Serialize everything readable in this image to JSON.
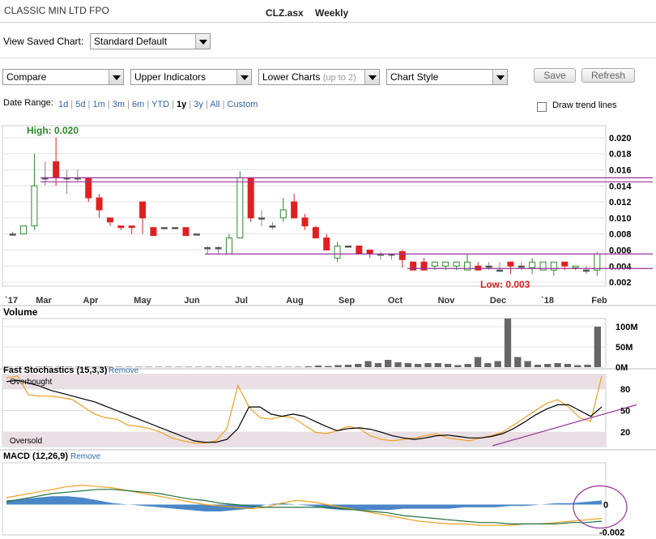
{
  "header": {
    "company": "CLASSIC MIN LTD FPO",
    "ticker": "CLZ.asx",
    "period": "Weekly"
  },
  "saved_chart": {
    "label": "View Saved Chart:",
    "value": "Standard Default"
  },
  "toolbar": {
    "compare": "Compare",
    "upper": "Upper Indicators",
    "lower": "Lower Charts",
    "lower_hint": "(up to 2)",
    "style": "Chart Style",
    "save": "Save",
    "refresh": "Refresh"
  },
  "date_range": {
    "label": "Date Range:",
    "options": [
      "1d",
      "5d",
      "1m",
      "3m",
      "6m",
      "YTD",
      "1y",
      "3y",
      "All",
      "Custom"
    ],
    "selected": "1y"
  },
  "trend": {
    "label": "Draw trend lines",
    "checked": false
  },
  "colors": {
    "up": "#2e8b2e",
    "down": "#e02020",
    "neutral": "#555555",
    "bar": "#666666",
    "stoch_fast": "#f0a020",
    "stoch_slow": "#000000",
    "macd_line": "#f0a020",
    "signal_line": "#207040",
    "hist": "#4a86c8",
    "trend": "#993399",
    "high": "#2a8a2a",
    "low": "#e02020"
  },
  "chart_data": [
    {
      "type": "candlestick",
      "title": "",
      "high_label": "High: 0.020",
      "low_label": "Low: 0.003",
      "y_ticks": [
        "0.020",
        "0.018",
        "0.016",
        "0.014",
        "0.012",
        "0.010",
        "0.008",
        "0.006",
        "0.004",
        "0.002"
      ],
      "ylim": [
        0.0015,
        0.0215
      ],
      "x_labels": [
        "`17",
        "Mar",
        "Apr",
        "May",
        "Jun",
        "Jul",
        "Aug",
        "Sep",
        "Oct",
        "Nov",
        "Dec",
        "`18",
        "Feb"
      ],
      "ohlc": [
        [
          0.008,
          0.0083,
          0.0078,
          0.008
        ],
        [
          0.008,
          0.009,
          0.008,
          0.009
        ],
        [
          0.009,
          0.018,
          0.0085,
          0.014
        ],
        [
          0.015,
          0.017,
          0.014,
          0.015
        ],
        [
          0.017,
          0.02,
          0.014,
          0.015
        ],
        [
          0.015,
          0.016,
          0.013,
          0.015
        ],
        [
          0.015,
          0.016,
          0.0145,
          0.015
        ],
        [
          0.015,
          0.015,
          0.012,
          0.0125
        ],
        [
          0.0125,
          0.013,
          0.01,
          0.011
        ],
        [
          0.01,
          0.01,
          0.009,
          0.0095
        ],
        [
          0.009,
          0.009,
          0.0085,
          0.0088
        ],
        [
          0.009,
          0.009,
          0.008,
          0.0088
        ],
        [
          0.012,
          0.012,
          0.008,
          0.01
        ],
        [
          0.0088,
          0.0088,
          0.0078,
          0.0078
        ],
        [
          0.0088,
          0.0088,
          0.0088,
          0.0088
        ],
        [
          0.0088,
          0.0088,
          0.0088,
          0.0088
        ],
        [
          0.0088,
          0.0088,
          0.0078,
          0.0078
        ],
        [
          0.008,
          0.008,
          0.008,
          0.008
        ],
        [
          0.0063,
          0.0065,
          0.0055,
          0.0063
        ],
        [
          0.0063,
          0.0065,
          0.0055,
          0.0063
        ],
        [
          0.0055,
          0.008,
          0.0055,
          0.0075
        ],
        [
          0.0075,
          0.0158,
          0.0075,
          0.015
        ],
        [
          0.015,
          0.015,
          0.0095,
          0.01
        ],
        [
          0.01,
          0.011,
          0.009,
          0.01
        ],
        [
          0.009,
          0.0095,
          0.0085,
          0.009
        ],
        [
          0.01,
          0.0125,
          0.0095,
          0.011
        ],
        [
          0.012,
          0.013,
          0.01,
          0.01
        ],
        [
          0.01,
          0.0105,
          0.0085,
          0.009
        ],
        [
          0.0088,
          0.009,
          0.0075,
          0.0075
        ],
        [
          0.0075,
          0.008,
          0.006,
          0.006
        ],
        [
          0.005,
          0.007,
          0.0045,
          0.0065
        ],
        [
          0.0065,
          0.0065,
          0.0065,
          0.0065
        ],
        [
          0.0065,
          0.0065,
          0.0055,
          0.0055
        ],
        [
          0.006,
          0.006,
          0.005,
          0.0055
        ],
        [
          0.0055,
          0.0058,
          0.0048,
          0.0055
        ],
        [
          0.0055,
          0.0055,
          0.0048,
          0.0055
        ],
        [
          0.0058,
          0.006,
          0.0038,
          0.0048
        ],
        [
          0.0045,
          0.0045,
          0.0035,
          0.0035
        ],
        [
          0.0045,
          0.005,
          0.0035,
          0.0035
        ],
        [
          0.004,
          0.0045,
          0.0035,
          0.0045
        ],
        [
          0.004,
          0.0045,
          0.0035,
          0.0045
        ],
        [
          0.004,
          0.0045,
          0.0035,
          0.0045
        ],
        [
          0.0035,
          0.0055,
          0.0035,
          0.0045
        ],
        [
          0.004,
          0.0045,
          0.0035,
          0.0035
        ],
        [
          0.004,
          0.0045,
          0.0035,
          0.004
        ],
        [
          0.0035,
          0.0045,
          0.0035,
          0.0035
        ],
        [
          0.0045,
          0.0045,
          0.003,
          0.004
        ],
        [
          0.004,
          0.0045,
          0.0035,
          0.004
        ],
        [
          0.0038,
          0.005,
          0.003,
          0.0045
        ],
        [
          0.0035,
          0.0045,
          0.0035,
          0.0045
        ],
        [
          0.0035,
          0.0045,
          0.0028,
          0.0045
        ],
        [
          0.0045,
          0.0045,
          0.0035,
          0.004
        ],
        [
          0.0038,
          0.004,
          0.0035,
          0.004
        ],
        [
          0.0035,
          0.004,
          0.003,
          0.0035
        ],
        [
          0.0035,
          0.0058,
          0.0028,
          0.0055
        ]
      ],
      "resistance": 0.015,
      "resistance2": 0.0145,
      "support": 0.0055,
      "support2": 0.0037
    },
    {
      "type": "bar",
      "title": "Volume",
      "y_ticks": [
        "100M",
        "50M",
        "0M"
      ],
      "ylim": [
        0,
        120
      ],
      "values": [
        1,
        1,
        1,
        1,
        1,
        1,
        1,
        1,
        1,
        1,
        1,
        1,
        1,
        1,
        1,
        1,
        1,
        1,
        1,
        1,
        1,
        1,
        1,
        1,
        1,
        1,
        1,
        1,
        1,
        1,
        2,
        4,
        3,
        5,
        6,
        8,
        15,
        10,
        18,
        12,
        10,
        8,
        10,
        10,
        8,
        5,
        8,
        25,
        10,
        15,
        120,
        25,
        15,
        6,
        8,
        10,
        8,
        5,
        6,
        100
      ]
    },
    {
      "type": "line",
      "title": "Fast Stochastics (15,3,3)",
      "remove": "Remove",
      "overbought": "Overbought",
      "oversold": "Oversold",
      "y_ticks": [
        "80",
        "50",
        "20"
      ],
      "ylim": [
        0,
        100
      ],
      "fast": [
        95,
        98,
        72,
        70,
        70,
        68,
        65,
        55,
        45,
        40,
        38,
        30,
        28,
        25,
        20,
        12,
        8,
        5,
        5,
        8,
        25,
        85,
        55,
        40,
        38,
        42,
        40,
        30,
        20,
        18,
        22,
        28,
        25,
        15,
        10,
        8,
        10,
        12,
        15,
        18,
        12,
        10,
        8,
        12,
        15,
        20,
        30,
        40,
        50,
        60,
        65,
        55,
        40,
        35,
        98
      ],
      "slow": [
        90,
        92,
        88,
        84,
        78,
        74,
        70,
        66,
        62,
        56,
        50,
        44,
        38,
        32,
        26,
        20,
        14,
        8,
        6,
        6,
        10,
        25,
        55,
        55,
        45,
        42,
        45,
        42,
        35,
        28,
        22,
        25,
        26,
        24,
        20,
        15,
        12,
        10,
        12,
        15,
        16,
        14,
        12,
        12,
        14,
        18,
        25,
        34,
        44,
        52,
        58,
        58,
        50,
        42,
        55
      ],
      "trend_from": [
        17,
        38
      ],
      "trend_to": [
        100,
        55
      ]
    },
    {
      "type": "line",
      "title": "MACD (12,26,9)",
      "remove": "Remove",
      "y_ticks": [
        "0",
        "-0.002"
      ],
      "ylim": [
        -0.0022,
        0.0022
      ],
      "macd": [
        0.0005,
        0.0007,
        0.0009,
        0.0011,
        0.0013,
        0.0014,
        0.0013,
        0.0012,
        0.001,
        0.0008,
        0.0006,
        0.0004,
        0.0002,
        0.0,
        -0.0001,
        -0.0002,
        -0.0003,
        -0.0002,
        0.0001,
        0.0003,
        0.0002,
        0.0,
        -0.0002,
        -0.0004,
        -0.0006,
        -0.0008,
        -0.001,
        -0.0012,
        -0.0013,
        -0.0014,
        -0.0014,
        -0.0015,
        -0.0015,
        -0.0015,
        -0.0014,
        -0.0014,
        -0.0013,
        -0.0012,
        -0.0011,
        -0.001
      ],
      "signal": [
        0.0002,
        0.0004,
        0.0006,
        0.0008,
        0.0009,
        0.001,
        0.0011,
        0.0011,
        0.001,
        0.0009,
        0.0008,
        0.0006,
        0.0004,
        0.0003,
        0.0001,
        0.0,
        -0.0001,
        -0.0002,
        -0.0002,
        -0.0002,
        -0.0002,
        -0.0002,
        -0.0003,
        -0.0004,
        -0.0005,
        -0.0006,
        -0.0008,
        -0.0009,
        -0.001,
        -0.0011,
        -0.0012,
        -0.0013,
        -0.0013,
        -0.0014,
        -0.0014,
        -0.0014,
        -0.0014,
        -0.0013,
        -0.0013,
        -0.0012
      ],
      "hist": [
        0.0003,
        0.0004,
        0.0005,
        0.0006,
        0.0006,
        0.0005,
        0.0003,
        0.0001,
        0.0,
        -0.0001,
        -0.0002,
        -0.0003,
        -0.0004,
        -0.0005,
        -0.0005,
        -0.0004,
        -0.0003,
        0.0,
        0.0001,
        0.0,
        -0.0001,
        -0.0003,
        -0.0004,
        -0.0004,
        -0.0004,
        -0.0004,
        -0.0003,
        -0.0003,
        -0.0003,
        -0.0003,
        -0.0002,
        -0.0002,
        -0.0002,
        -0.0001,
        -0.0001,
        0.0,
        0.0001,
        0.0001,
        0.0002,
        0.0003
      ]
    }
  ]
}
